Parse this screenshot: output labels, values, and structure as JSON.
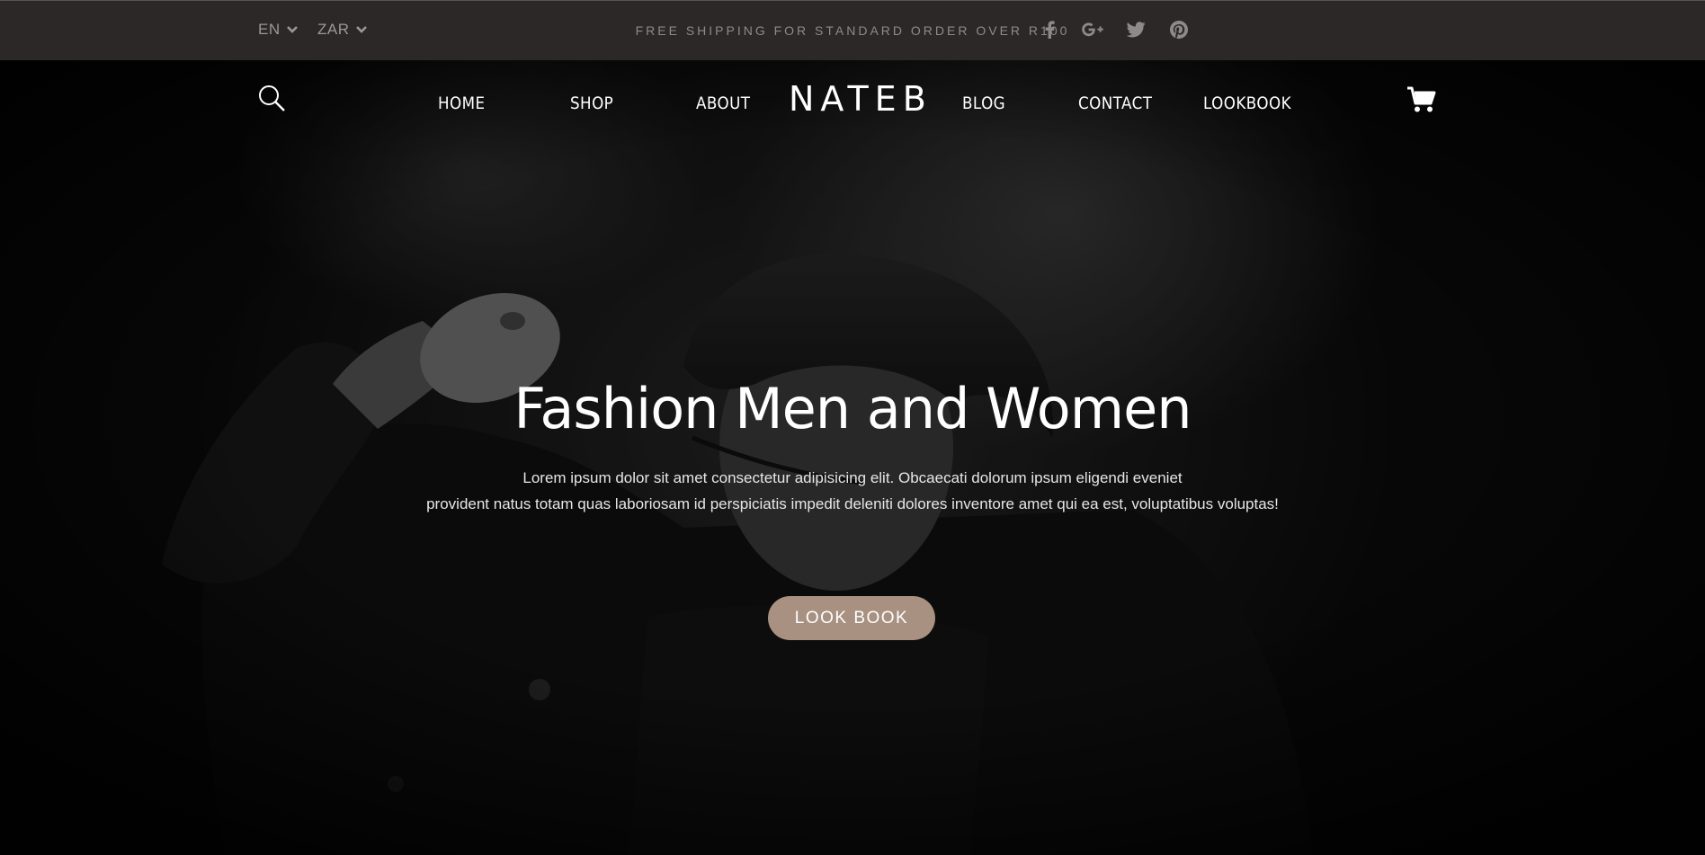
{
  "topbar": {
    "language": "EN",
    "currency": "ZAR",
    "shipping_notice": "FREE SHIPPING FOR STANDARD ORDER OVER R100",
    "socials": [
      "facebook-icon",
      "google-plus-icon",
      "twitter-icon",
      "pinterest-icon"
    ]
  },
  "nav": {
    "left_links": [
      "HOME",
      "SHOP",
      "ABOUT"
    ],
    "logo": "NATEB",
    "right_links": [
      "BLOG",
      "CONTACT",
      "LOOKBOOK"
    ],
    "icons": [
      "search-icon",
      "cart-icon"
    ]
  },
  "hero": {
    "title": "Fashion Men and Women",
    "text_line1": "Lorem ipsum dolor sit amet consectetur adipisicing elit. Obcaecati dolorum ipsum eligendi eveniet",
    "text_line2": "provident natus totam quas laboriosam id perspiciatis impedit deleniti dolores inventore amet qui ea est, voluptatibus voluptas!",
    "button_label": "LOOK BOOK"
  },
  "colors": {
    "topbar_bg": "#2d2828",
    "topbar_text": "#8f8a8a",
    "accent_button": "#a89181",
    "hero_bg": "#0b0b0b",
    "text_primary": "#ffffff"
  }
}
